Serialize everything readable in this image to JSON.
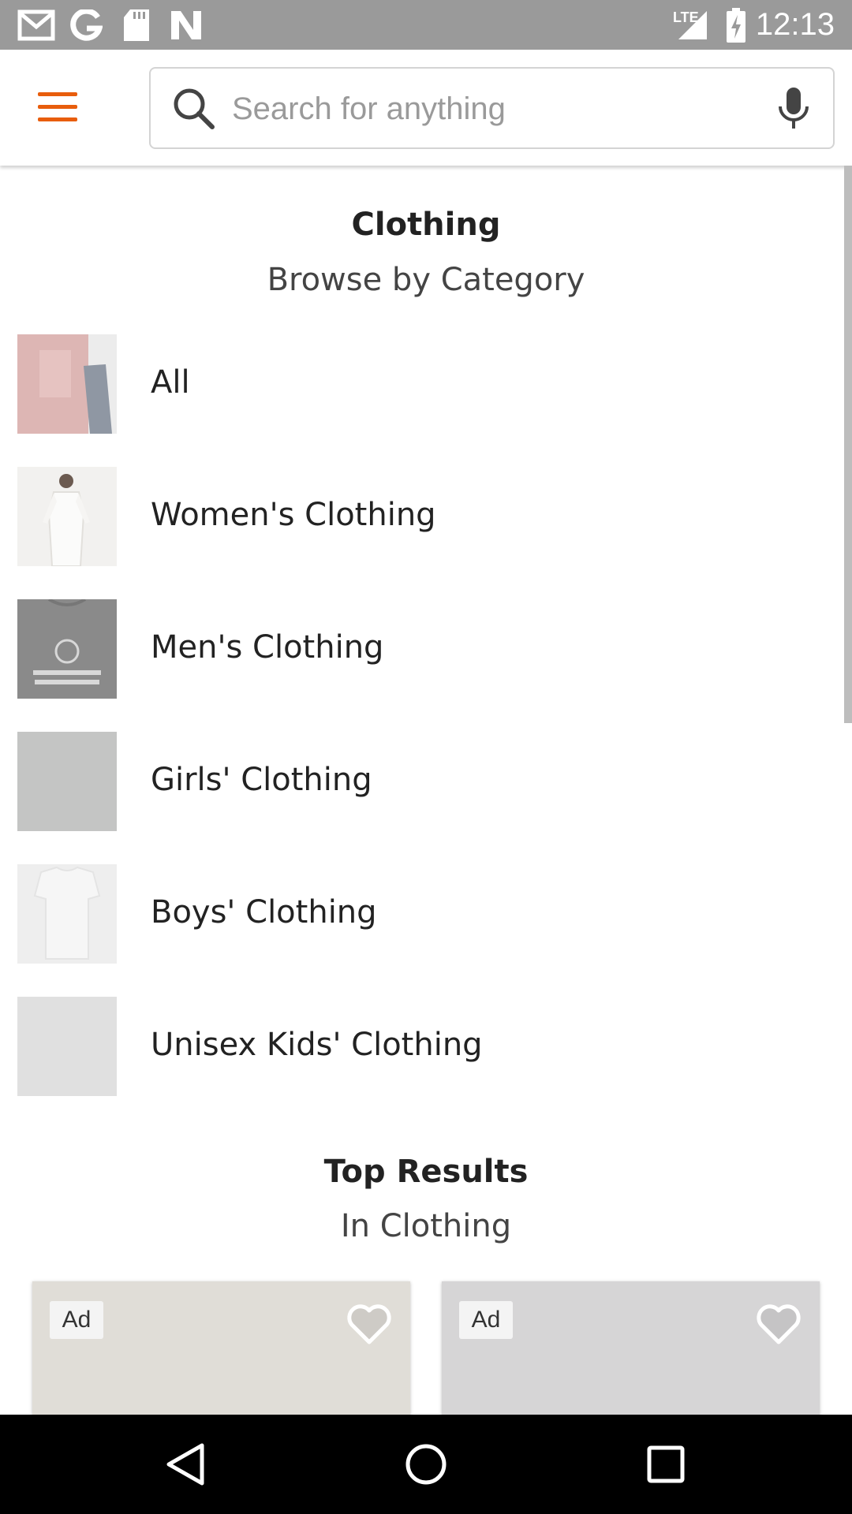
{
  "status_bar": {
    "time": "12:13",
    "network": "LTE",
    "left_icons": [
      "gmail-icon",
      "google-icon",
      "sd-card-icon",
      "n-icon"
    ]
  },
  "search": {
    "placeholder": "Search for anything",
    "value": ""
  },
  "category": {
    "title": "Clothing",
    "subtitle": "Browse by Category",
    "items": [
      {
        "label": "All"
      },
      {
        "label": "Women's Clothing"
      },
      {
        "label": "Men's Clothing"
      },
      {
        "label": "Girls' Clothing"
      },
      {
        "label": "Boys' Clothing"
      },
      {
        "label": "Unisex Kids' Clothing"
      }
    ]
  },
  "top_results": {
    "title": "Top Results",
    "subtitle": "In Clothing",
    "cards": [
      {
        "badge": "Ad"
      },
      {
        "badge": "Ad"
      }
    ]
  },
  "colors": {
    "accent": "#e85d0c",
    "status_bar": "#9a9a9a",
    "nav_bar": "#000000"
  }
}
